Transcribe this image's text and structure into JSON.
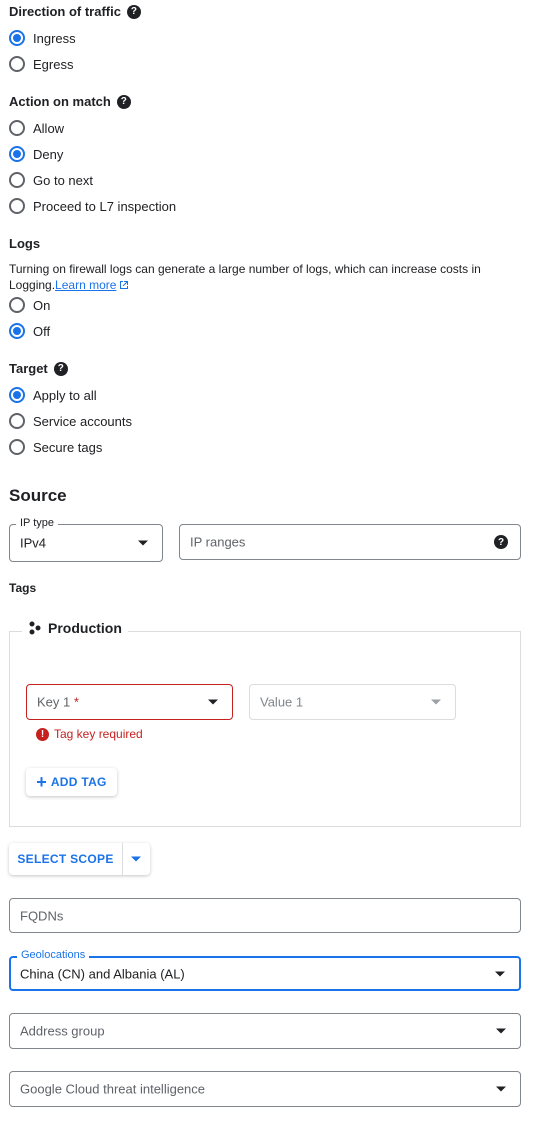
{
  "direction": {
    "title": "Direction of traffic",
    "options": [
      "Ingress",
      "Egress"
    ],
    "selected": "Ingress"
  },
  "action": {
    "title": "Action on match",
    "options": [
      "Allow",
      "Deny",
      "Go to next",
      "Proceed to L7 inspection"
    ],
    "selected": "Deny"
  },
  "logs": {
    "title": "Logs",
    "description": "Turning on firewall logs can generate a large number of logs, which can increase costs in",
    "description_line2": "Logging.",
    "learn_more": "Learn more",
    "options": [
      "On",
      "Off"
    ],
    "selected": "Off"
  },
  "target": {
    "title": "Target",
    "options": [
      "Apply to all",
      "Service accounts",
      "Secure tags"
    ],
    "selected": "Apply to all"
  },
  "source": {
    "title": "Source",
    "ip_type_label": "IP type",
    "ip_type_value": "IPv4",
    "ip_ranges_placeholder": "IP ranges",
    "tags_label": "Tags",
    "production_title": "Production",
    "key_placeholder": "Key 1",
    "key_required_star": "*",
    "value_placeholder": "Value 1",
    "error_text": "Tag key required",
    "add_tag_label": "ADD TAG",
    "select_scope_label": "SELECT SCOPE",
    "fqdns_placeholder": "FQDNs",
    "geolocations_label": "Geolocations",
    "geolocations_value": "China (CN) and Albania (AL)",
    "address_group_placeholder": "Address group",
    "threat_intel_placeholder": "Google Cloud threat intelligence"
  },
  "colors": {
    "accent": "#1a73e8",
    "error": "#c5221f",
    "text": "#202124"
  }
}
